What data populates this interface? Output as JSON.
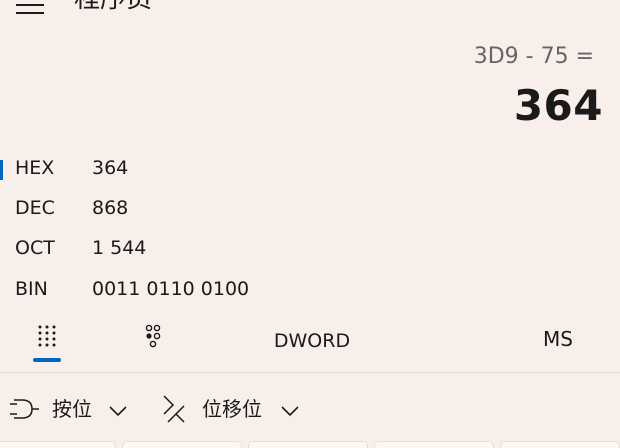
{
  "header": {
    "title": "程序员"
  },
  "display": {
    "expression": "3D9 - 75 =",
    "result": "364"
  },
  "radix": [
    {
      "label": "HEX",
      "value": "364",
      "active": true
    },
    {
      "label": "DEC",
      "value": "868",
      "active": false
    },
    {
      "label": "OCT",
      "value": "1 544",
      "active": false
    },
    {
      "label": "BIN",
      "value": "0011 0110 0100",
      "active": false
    }
  ],
  "toolbar": {
    "keypad_icon": "full-keypad-icon",
    "bitflip_icon": "bit-toggling-keypad-icon",
    "word_size": "DWORD",
    "memory": "MS"
  },
  "operations": {
    "bitwise_label": "按位",
    "bitwise_icon": "logic-gate-icon",
    "shift_label": "位移位",
    "shift_icon": "bit-shift-icon"
  },
  "colors": {
    "background": "#f8efeb",
    "accent": "#0067c0",
    "text": "#1a1a1a",
    "muted": "#666666"
  }
}
